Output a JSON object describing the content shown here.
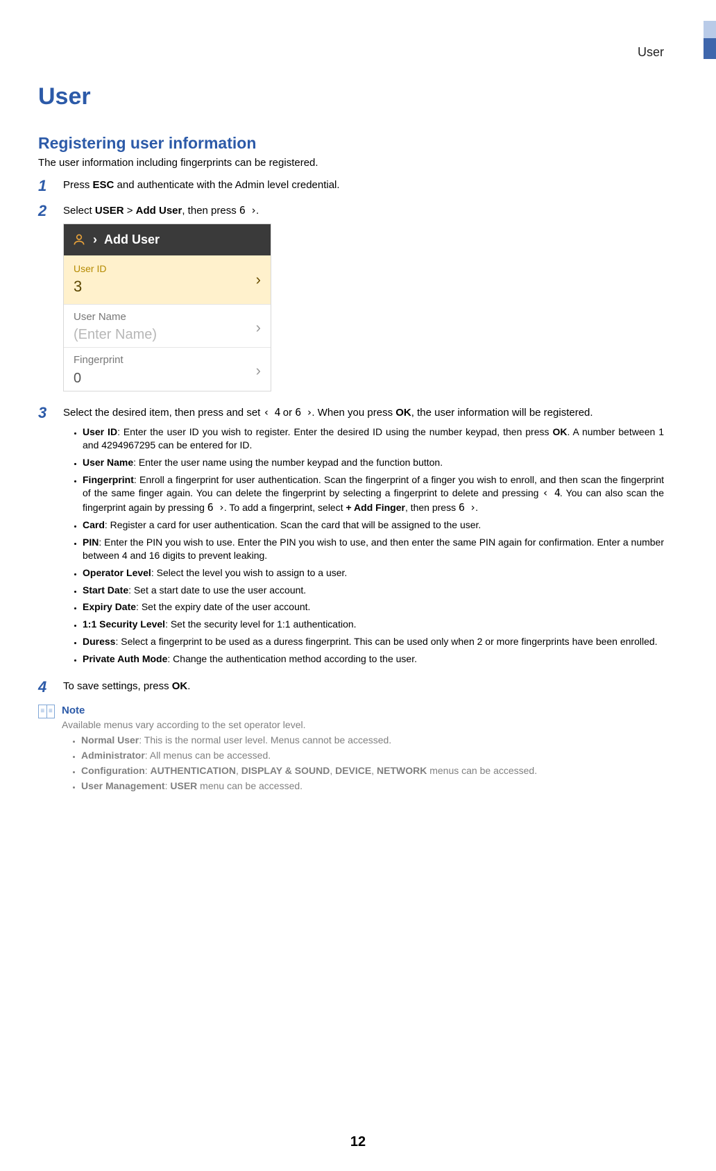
{
  "header": {
    "section": "User"
  },
  "title": "User",
  "section_heading": "Registering user information",
  "intro": "The user information including fingerprints can be registered.",
  "keys": {
    "left4": "‹ 4",
    "right6": "6 ›",
    "left4_inline": "‹ 4",
    "right6_inline": "6 ›"
  },
  "steps": {
    "s1": {
      "num": "1",
      "t_pre": "Press ",
      "t_esc": "ESC",
      "t_post": " and authenticate with the Admin level credential."
    },
    "s2": {
      "num": "2",
      "t_a": "Select ",
      "t_user": "USER",
      "t_gt": " > ",
      "t_add": "Add User",
      "t_b": ", then press ",
      "t_c": "."
    },
    "s3": {
      "num": "3",
      "line_a": "Select the desired item, then press and set ",
      "line_b": " or ",
      "line_c": ". When you press ",
      "ok": "OK",
      "line_d": ", the user information will be registered.",
      "bullets": [
        {
          "k": "User ID",
          "t_a": ": Enter the user ID you wish to register. Enter the desired ID using the number keypad, then press ",
          "ok": "OK",
          "t_b": ". A number between 1 and 4294967295 can be entered for ID."
        },
        {
          "k": "User Name",
          "t": ": Enter the user name using the number keypad and the function button."
        },
        {
          "k": "Fingerprint",
          "t_a": ": Enroll a fingerprint for user authentication. Scan the fingerprint of a finger you wish to enroll, and then scan the fingerprint of the same finger again. You can delete the fingerprint by selecting a fingerprint to delete and pressing ",
          "t_b": ". You can also scan the fingerprint again by pressing ",
          "t_c": ". To add a fingerprint, select ",
          "add_finger": "+ Add Finger",
          "t_d": ", then press ",
          "t_e": "."
        },
        {
          "k": "Card",
          "t": ": Register a card for user authentication. Scan the card that will be assigned to the user."
        },
        {
          "k": "PIN",
          "t": ": Enter the PIN you wish to use. Enter the PIN you wish to use, and then enter the same PIN again for confirmation. Enter a number between 4 and 16 digits to prevent leaking."
        },
        {
          "k": "Operator Level",
          "t": ": Select the level you wish to assign to a user."
        },
        {
          "k": "Start Date",
          "t": ": Set a start date to use the user account."
        },
        {
          "k": "Expiry Date",
          "t": ": Set the expiry date of the user account."
        },
        {
          "k": "1:1 Security Level",
          "t": ": Set the security level for 1:1 authentication."
        },
        {
          "k": "Duress",
          "t": ": Select a fingerprint to be used as a duress fingerprint. This can be used only when 2 or more fingerprints have been enrolled."
        },
        {
          "k": "Private Auth Mode",
          "t": ": Change the authentication method according to the user."
        }
      ]
    },
    "s4": {
      "num": "4",
      "t_a": "To save settings, press ",
      "ok": "OK",
      "t_b": "."
    }
  },
  "device": {
    "breadcrumb_sep": "›",
    "breadcrumb_title": "Add User",
    "rows": {
      "user_id": {
        "label": "User ID",
        "value": "3"
      },
      "user_name": {
        "label": "User Name",
        "placeholder": "(Enter Name)"
      },
      "fingerprint": {
        "label": "Fingerprint",
        "value": "0"
      }
    }
  },
  "note": {
    "title": "Note",
    "intro": "Available menus vary according to the set operator level.",
    "items": [
      {
        "k": "Normal User",
        "t": ": This is the normal user level. Menus cannot be accessed."
      },
      {
        "k": "Administrator",
        "t": ": All menus can be accessed."
      },
      {
        "k": "Configuration",
        "t_a": ": ",
        "m1": "AUTHENTICATION",
        "c1": ", ",
        "m2": "DISPLAY & SOUND",
        "c2": ", ",
        "m3": "DEVICE",
        "c3": ", ",
        "m4": "NETWORK",
        "t_b": " menus can be accessed."
      },
      {
        "k": "User Management",
        "t_a": ": ",
        "m1": "USER",
        "t_b": " menu can be accessed."
      }
    ]
  },
  "page_number": "12"
}
